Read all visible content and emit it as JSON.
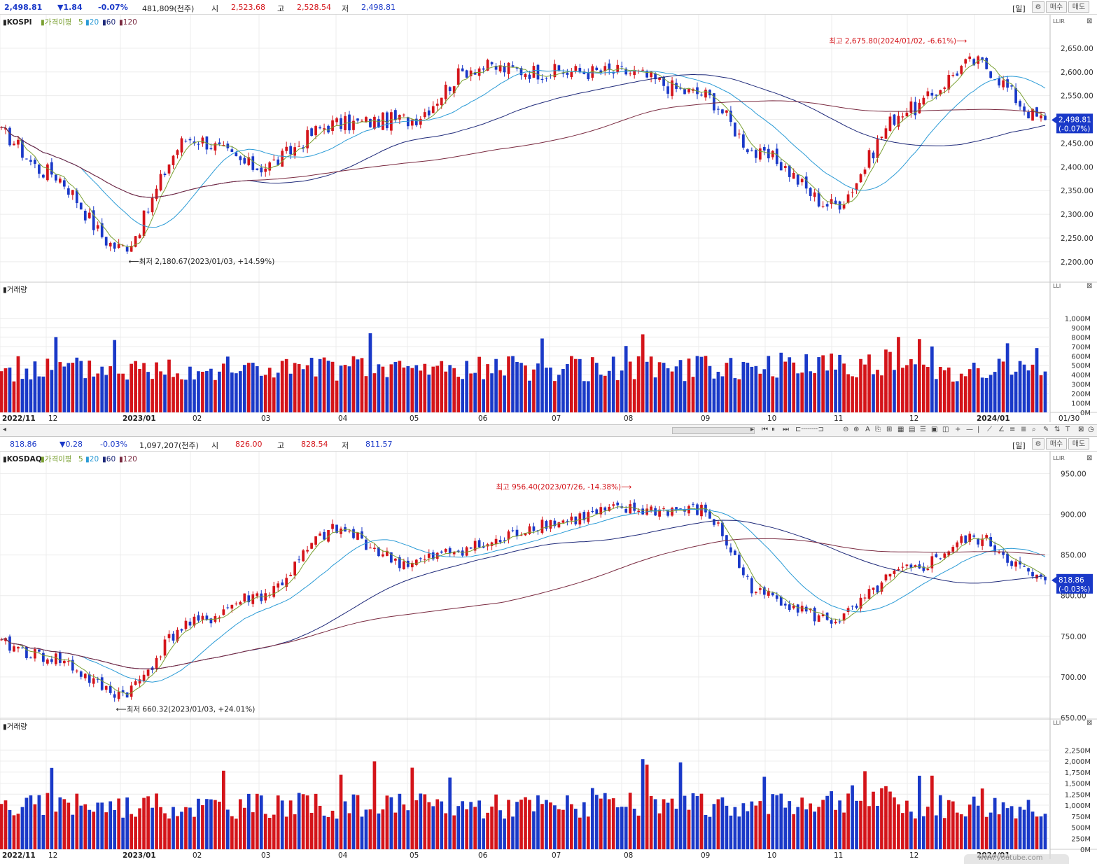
{
  "kospi_bar": {
    "price": "2,498.81",
    "change": "▼1.84",
    "pct": "-0.07%",
    "volume": "481,809(천주)",
    "open_label": "시",
    "open": "2,523.68",
    "high_label": "고",
    "high": "2,528.54",
    "low_label": "저",
    "low": "2,498.81",
    "period": "[일]",
    "buy": "매수",
    "sell": "매도"
  },
  "kosdaq_bar": {
    "price": "818.86",
    "change": "▼0.28",
    "pct": "-0.03%",
    "volume": "1,097,207(천주)",
    "open_label": "시",
    "open": "826.00",
    "high_label": "고",
    "high": "828.54",
    "low_label": "저",
    "low": "811.57",
    "period": "[일]",
    "buy": "매수",
    "sell": "매도"
  },
  "toolbar": {
    "date": "01/30"
  },
  "watermark": "www.youtube.com",
  "colors": {
    "up": "#d4141a",
    "down": "#1a39c8",
    "ma5": "#7aa032",
    "ma20": "#2b9bd6",
    "ma60": "#1f2a7a",
    "ma120": "#7a2a40",
    "grid": "#ececec"
  },
  "chart_data": [
    {
      "type": "candlestick",
      "title": "KOSPI",
      "legend": [
        "가격이평",
        "5",
        "20",
        "60",
        "120"
      ],
      "x_ticks": [
        "2022/11",
        "12",
        "2023/01",
        "02",
        "03",
        "04",
        "05",
        "06",
        "07",
        "08",
        "09",
        "10",
        "11",
        "12",
        "2024/01"
      ],
      "y_ticks": [
        "2,650.00",
        "2,600.00",
        "2,550.00",
        "2,500.00",
        "2,450.00",
        "2,400.00",
        "2,350.00",
        "2,300.00",
        "2,250.00",
        "2,200.00"
      ],
      "ylim": [
        2160,
        2700
      ],
      "last_price": "2,498.81",
      "last_pct": "(-0.07%)",
      "high_annotation": "최고 2,675.80(2024/01/02, -6.61%)",
      "low_annotation": "최저 2,180.67(2023/01/03, +14.59%)",
      "anchors": [
        {
          "month": "2022/11",
          "value": 2470
        },
        {
          "month": "12",
          "value": 2390
        },
        {
          "month": "2023/01",
          "value": 2230
        },
        {
          "month": "02",
          "value": 2460
        },
        {
          "month": "03",
          "value": 2400
        },
        {
          "month": "04",
          "value": 2490
        },
        {
          "month": "05",
          "value": 2500
        },
        {
          "month": "06",
          "value": 2610
        },
        {
          "month": "07",
          "value": 2600
        },
        {
          "month": "08",
          "value": 2600
        },
        {
          "month": "09",
          "value": 2555
        },
        {
          "month": "10",
          "value": 2420
        },
        {
          "month": "11",
          "value": 2320
        },
        {
          "month": "12",
          "value": 2520
        },
        {
          "month": "2024/01",
          "value": 2620
        },
        {
          "month": "01/30",
          "value": 2498.81
        }
      ],
      "volume_title": "거래량",
      "volume_ticks": [
        "1,000M",
        "900M",
        "800M",
        "700M",
        "600M",
        "500M",
        "400M",
        "300M",
        "200M",
        "100M",
        "0M"
      ],
      "volume_max": 1100
    },
    {
      "type": "candlestick",
      "title": "KOSDAQ",
      "legend": [
        "가격이평",
        "5",
        "20",
        "60",
        "120"
      ],
      "x_ticks": [
        "2022/11",
        "12",
        "2023/01",
        "02",
        "03",
        "04",
        "05",
        "06",
        "07",
        "08",
        "09",
        "10",
        "11",
        "12",
        "2024/01"
      ],
      "y_ticks": [
        "950.00",
        "900.00",
        "850.00",
        "800.00",
        "750.00",
        "700.00",
        "650.00"
      ],
      "ylim": [
        650,
        965
      ],
      "last_price": "818.86",
      "last_pct": "(-0.03%)",
      "high_annotation": "최고 956.40(2023/07/26, -14.38%)",
      "low_annotation": "최저 660.32(2023/01/03, +24.01%)",
      "anchors": [
        {
          "month": "2022/11",
          "value": 740
        },
        {
          "month": "12",
          "value": 725
        },
        {
          "month": "2023/01",
          "value": 680
        },
        {
          "month": "02",
          "value": 765
        },
        {
          "month": "03",
          "value": 800
        },
        {
          "month": "04",
          "value": 880
        },
        {
          "month": "05",
          "value": 840
        },
        {
          "month": "06",
          "value": 860
        },
        {
          "month": "07",
          "value": 890
        },
        {
          "month": "08",
          "value": 905
        },
        {
          "month": "09",
          "value": 905
        },
        {
          "month": "10",
          "value": 800
        },
        {
          "month": "11",
          "value": 770
        },
        {
          "month": "12",
          "value": 830
        },
        {
          "month": "2024/01",
          "value": 870
        },
        {
          "month": "01/30",
          "value": 818.86
        }
      ],
      "volume_title": "거래량",
      "volume_ticks": [
        "2,250M",
        "2,000M",
        "1,750M",
        "1,500M",
        "1,250M",
        "1,000M",
        "750M",
        "500M",
        "250M",
        "0M"
      ],
      "volume_max": 2350
    }
  ]
}
